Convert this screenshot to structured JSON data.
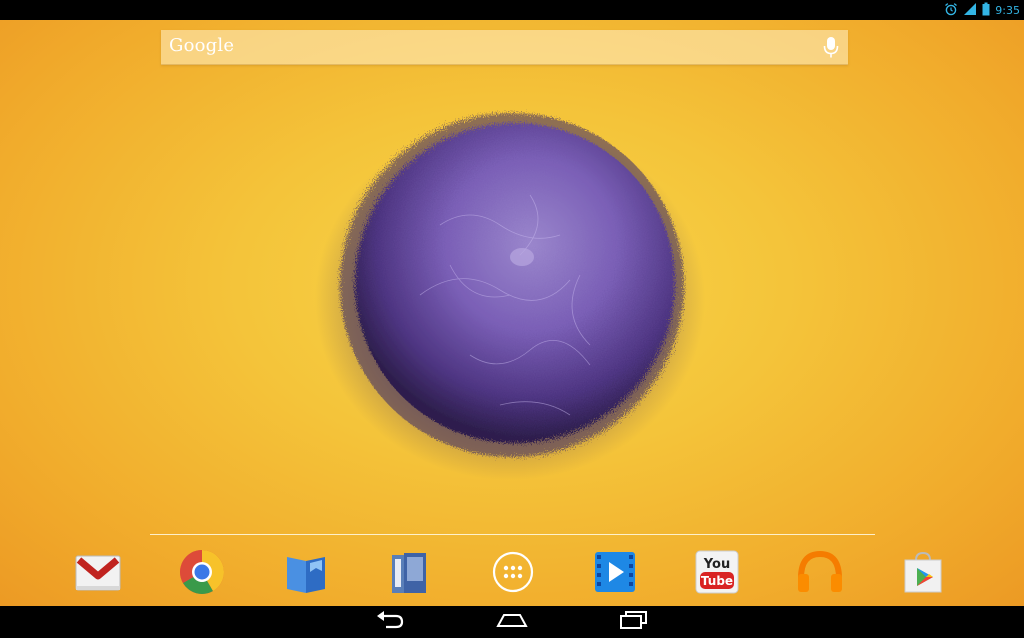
{
  "status_bar": {
    "time": "9:35",
    "icons": [
      "alarm-icon",
      "signal-icon",
      "battery-icon"
    ],
    "accent_color": "#33b5e5"
  },
  "search_widget": {
    "label": "Google",
    "mic_icon": "microphone-icon"
  },
  "wallpaper": {
    "subject": "purple-fuzzball",
    "colors": {
      "background": "#f4c43a",
      "fuzz": "#6b4fa3"
    }
  },
  "dock": {
    "apps": [
      {
        "icon": "gmail-icon"
      },
      {
        "icon": "chrome-icon"
      },
      {
        "icon": "play-books-icon"
      },
      {
        "icon": "play-magazines-icon"
      },
      {
        "icon": "app-drawer-icon"
      },
      {
        "icon": "play-movies-icon"
      },
      {
        "icon": "youtube-icon",
        "text_top": "You",
        "text_bottom": "Tube"
      },
      {
        "icon": "play-music-icon"
      },
      {
        "icon": "play-store-icon"
      }
    ]
  },
  "nav_bar": {
    "buttons": [
      "back-icon",
      "home-icon",
      "recent-apps-icon"
    ]
  }
}
